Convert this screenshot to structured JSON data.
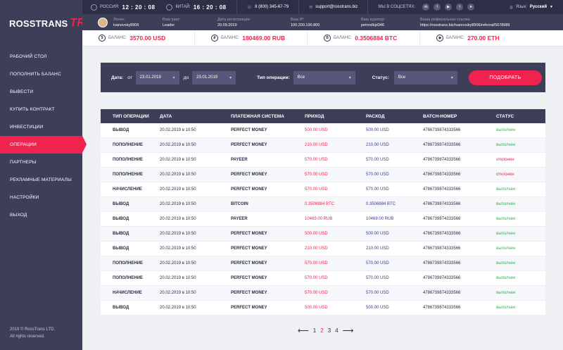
{
  "brand": {
    "logo_text": "ROSSTRANS",
    "logo_mark": "TR",
    "copyright_line1": "2019 © RossTrans LTD.",
    "copyright_line2": "All rights reserved."
  },
  "nav": [
    {
      "label": "Рабочий стол"
    },
    {
      "label": "Пополнить баланс"
    },
    {
      "label": "Вывести"
    },
    {
      "label": "Купить контракт"
    },
    {
      "label": "Инвестиции"
    },
    {
      "label": "Операции",
      "active": true
    },
    {
      "label": "Партнеры"
    },
    {
      "label": "Рекламные материалы"
    },
    {
      "label": "Настройки"
    },
    {
      "label": "Выход"
    }
  ],
  "topbar": {
    "russia_label": "РОССИЯ:",
    "russia_time": "12 : 20 : 08",
    "china_label": "КИТАЙ:",
    "china_time": "16 : 20 : 08",
    "phone": "8 (800) 345-67-79",
    "email": "support@rosstrans.biz",
    "social_label": "МЫ В СОЦСЕТЯХ:",
    "language_label": "Язык:",
    "language_value": "Русский"
  },
  "user": {
    "login_label": "Логин:",
    "login": "ivanovsky8906",
    "rank_label": "Ваш ранг:",
    "rank": "Leader",
    "reg_label": "Дата регистрации:",
    "reg_date": "20.09.2019",
    "ip_label": "Ваш IP:",
    "ip": "100.200.100.800",
    "curator_label": "Ваш куратор:",
    "curator": "petrovlbjd346",
    "ref_label": "Ваша реферальная ссылка:",
    "ref_link": "https://rosstrans.biz/ivanovsky8906/referral/5678989"
  },
  "balances": [
    {
      "label": "БАЛАНС:",
      "value": "3570.00 USD",
      "icon": "$"
    },
    {
      "label": "БАЛАНС:",
      "value": "180469.00 RUB",
      "icon": "₽"
    },
    {
      "label": "БАЛАНС:",
      "value": "0.3506884 BTC",
      "icon": "B"
    },
    {
      "label": "БАЛАНС:",
      "value": "270.00 ETH",
      "icon": "◆"
    }
  ],
  "filter": {
    "date_label": "Дата:",
    "from_label": "от",
    "from_value": "23.01.2019",
    "to_label": "до",
    "to_value": "23.01.2019",
    "type_label": "Тип операции:",
    "type_value": "Все",
    "status_label": "Статус:",
    "status_value": "Все",
    "button": "ПОДОБРАТЬ"
  },
  "table": {
    "headers": [
      "ТИП ОПЕРАЦИИ",
      "ДАТА",
      "ПЛАТЕЖНАЯ СИСТЕМА",
      "ПРИХОД",
      "РАСХОД",
      "BATCH-НОМЕР",
      "СТАТУС"
    ],
    "rows": [
      [
        "ВЫВОД",
        "20.02.2019 в 10:50",
        "PERFECT MONEY",
        "500.00 USD",
        "500.00 USD",
        "4786739874333566",
        "выполнен",
        "ok"
      ],
      [
        "ПОПОЛНЕНИЕ",
        "20.02.2019 в 10:50",
        "PERFECT MONEY",
        "210.00 USD",
        "210.00 USD",
        "4786739874333566",
        "выполнен",
        "ok"
      ],
      [
        "ПОПОЛНЕНИЕ",
        "20.02.2019 в 10:50",
        "PAYEER",
        "570.00 USD",
        "570.00 USD",
        "4786739874333566",
        "отклонен",
        "no"
      ],
      [
        "ПОПОЛНЕНИЕ",
        "20.02.2019 в 10:50",
        "PERFECT MONEY",
        "570.00 USD",
        "570.00 USD",
        "4786739874333566",
        "отклонен",
        "no"
      ],
      [
        "НАЧИСЛЕНИЕ",
        "20.02.2019 в 10:50",
        "PERFECT MONEY",
        "570.00 USD",
        "570.00 USD",
        "4786739874333566",
        "выполнен",
        "ok"
      ],
      [
        "ВЫВОД",
        "20.02.2019 в 10:50",
        "BITCOIN",
        "0.3506884 BTC",
        "0.3506884 BTC",
        "4786739874333566",
        "выполнен",
        "ok"
      ],
      [
        "ВЫВОД",
        "20.02.2019 в 10:50",
        "PAYEER",
        "10469.00 RUB",
        "10469.00 RUB",
        "4786739874333566",
        "выполнен",
        "ok"
      ],
      [
        "ВЫВОД",
        "20.02.2019 в 10:50",
        "PERFECT MONEY",
        "500.00 USD",
        "500.00 USD",
        "4786739874333566",
        "выполнен",
        "ok"
      ],
      [
        "ВЫВОД",
        "20.02.2019 в 10:50",
        "PERFECT MONEY",
        "210.00 USD",
        "210.00 USD",
        "4786739874333566",
        "выполнен",
        "ok"
      ],
      [
        "ПОПОЛНЕНИЕ",
        "20.02.2019 в 10:50",
        "PERFECT MONEY",
        "570.00 USD",
        "570.00 USD",
        "4786739874333566",
        "выполнен",
        "ok"
      ],
      [
        "ПОПОЛНЕНИЕ",
        "20.02.2019 в 10:50",
        "PERFECT MONEY",
        "570.00 USD",
        "570.00 USD",
        "4786739874333566",
        "выполнен",
        "ok"
      ],
      [
        "НАЧИСЛЕНИЕ",
        "20.02.2019 в 10:50",
        "PERFECT MONEY",
        "570.00 USD",
        "570.00 USD",
        "4786739874333566",
        "выполнен",
        "ok"
      ],
      [
        "ВЫВОД",
        "20.02.2019 в 10:50",
        "PERFECT MONEY",
        "500.00 USD",
        "500.00 USD",
        "4786739874333566",
        "выполнен",
        "ok"
      ]
    ]
  },
  "pagination": {
    "prev": "⟵",
    "pages": [
      "1",
      "2",
      "3",
      "4"
    ],
    "active": "2",
    "next": "⟶"
  },
  "colors": {
    "accent": "#f0234e",
    "sidebar": "#3d3e58",
    "topbar": "#2e2f47",
    "success": "#2fb85a"
  }
}
